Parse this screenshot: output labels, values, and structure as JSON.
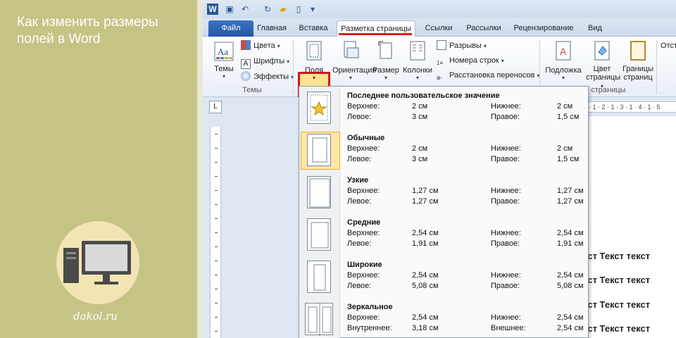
{
  "left_panel": {
    "title": "Как изменить размеры полей в Word",
    "site": "dakol.ru"
  },
  "ribbon_tabs": [
    {
      "label": "Файл"
    },
    {
      "label": "Главная"
    },
    {
      "label": "Вставка"
    },
    {
      "label": "Разметка страницы"
    },
    {
      "label": "Ссылки"
    },
    {
      "label": "Рассылки"
    },
    {
      "label": "Рецензирование"
    },
    {
      "label": "Вид"
    }
  ],
  "ribbon": {
    "themes": {
      "themes_label": "Темы",
      "colors_label": "Цвета",
      "fonts_label": "Шрифты",
      "effects_label": "Эффекты",
      "group_label": "Темы"
    },
    "page_setup": {
      "margins_label": "Поля",
      "orientation_label": "Ориентация",
      "size_label": "Размер",
      "columns_label": "Колонки",
      "breaks_label": "Разрывы",
      "line_numbers_label": "Номера строк",
      "hyphenation_label": "Расстановка переносов"
    },
    "background": {
      "watermark_label": "Подложка",
      "page_color_label_1": "Цвет",
      "page_color_label_2": "страницы",
      "page_borders_label_1": "Границы",
      "page_borders_label_2": "страниц",
      "group_label": "страницы"
    },
    "paragraph_partial": "Отст"
  },
  "ruler": {
    "horizontal_text": "· 1 · 2 · 1 · 3 · 1 · 4 · 1 · 5"
  },
  "document": {
    "lines": [
      "кст Текст текст",
      "кст Текст текст",
      "кст Текст текст",
      "кст Текст текст"
    ]
  },
  "margins_dropdown": {
    "presets": [
      {
        "name": "Последнее пользовательское значение",
        "top_label": "Верхнее:",
        "top": "2 см",
        "bottom_label": "Нижнее:",
        "bottom": "2 см",
        "left_label": "Левое:",
        "left": "3 см",
        "right_label": "Правое:",
        "right": "1,5 см",
        "icon": "star-icon",
        "selected": false
      },
      {
        "name": "Обычные",
        "top_label": "Верхнее:",
        "top": "2 см",
        "bottom_label": "Нижнее:",
        "bottom": "2 см",
        "left_label": "Левое:",
        "left": "3 см",
        "right_label": "Правое:",
        "right": "1,5 см",
        "icon": "page-normal-icon",
        "selected": true
      },
      {
        "name": "Узкие",
        "top_label": "Верхнее:",
        "top": "1,27 см",
        "bottom_label": "Нижнее:",
        "bottom": "1,27 см",
        "left_label": "Левое:",
        "left": "1,27 см",
        "right_label": "Правое:",
        "right": "1,27 см",
        "icon": "page-narrow-icon",
        "selected": false
      },
      {
        "name": "Средние",
        "top_label": "Верхнее:",
        "top": "2,54 см",
        "bottom_label": "Нижнее:",
        "bottom": "2,54 см",
        "left_label": "Левое:",
        "left": "1,91 см",
        "right_label": "Правое:",
        "right": "1,91 см",
        "icon": "page-moderate-icon",
        "selected": false
      },
      {
        "name": "Широкие",
        "top_label": "Верхнее:",
        "top": "2,54 см",
        "bottom_label": "Нижнее:",
        "bottom": "2,54 см",
        "left_label": "Левое:",
        "left": "5,08 см",
        "right_label": "Правое:",
        "right": "5,08 см",
        "icon": "page-wide-icon",
        "selected": false
      },
      {
        "name": "Зеркальное",
        "top_label": "Верхнее:",
        "top": "2,54 см",
        "bottom_label": "Нижнее:",
        "bottom": "2,54 см",
        "left_label": "Внутреннее:",
        "left": "3,18 см",
        "right_label": "Внешнее:",
        "right": "2,54 см",
        "icon": "page-mirrored-icon",
        "selected": false
      }
    ]
  },
  "colors": {
    "panel_bg": "#c6c485",
    "highlight_border": "#d9151b",
    "tab_underline": "#e41b17",
    "file_tab": "#2456a6",
    "selected_preset": "#fde7a3"
  }
}
